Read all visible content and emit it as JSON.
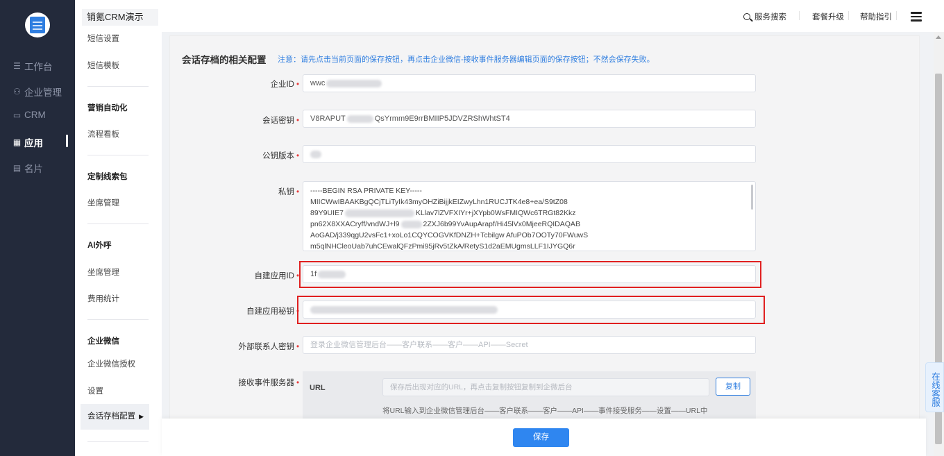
{
  "rail": {
    "items": [
      {
        "icon": "list-icon",
        "label": "工作台"
      },
      {
        "icon": "org-icon",
        "label": "企业管理"
      },
      {
        "icon": "crm-icon",
        "label": "CRM"
      },
      {
        "icon": "grid-icon",
        "label": "应用"
      },
      {
        "icon": "card-icon",
        "label": "名片"
      }
    ]
  },
  "submenu": {
    "title": "销氪CRM演示",
    "items": {
      "sms_settings": "短信设置",
      "sms_templates": "短信模板",
      "group_marketing": "营销自动化",
      "flow_board": "流程看板",
      "group_leads": "定制线索包",
      "seat_manage_1": "坐席管理",
      "group_ai": "AI外呼",
      "seat_manage_2": "坐席管理",
      "cost_stats": "费用统计",
      "group_wework": "企业微信",
      "wework_auth": "企业微信授权",
      "settings": "设置",
      "archive_config": "会话存档配置"
    }
  },
  "topbar": {
    "search": "服务搜索",
    "upgrade": "套餐升级",
    "help": "帮助指引"
  },
  "form": {
    "title": "会话存档的相关配置",
    "note": "注意：请先点击当前页面的保存按钮，再点击企业微信-接收事件服务器编辑页面的保存按钮；不然会保存失败。",
    "corp_id": {
      "label": "企业ID",
      "value_prefix": "wwc"
    },
    "session_secret": {
      "label": "会话密钥",
      "value_prefix": "V8RAPUT",
      "value_suffix": "QsYrmm9E9rrBMIIP5JDVZRShWhtST4"
    },
    "pubkey_version": {
      "label": "公钥版本",
      "value": ""
    },
    "private_key": {
      "label": "私钥",
      "lines": [
        "-----BEGIN RSA PRIVATE KEY-----",
        "MIICWwIBAAKBgQCjTLiTyIk43myOHZiBijjkEIZwyLhn1RUCJTK4e8+ea/S9tZ08",
        "89Y9UIE7",
        "KLlav7lZVFXIYr+jXYpb0WsFMIQWc6TRGt82Kkz",
        "pn62X8XXACryff/vndWJ+l9",
        "2ZXJ6b99YvAupArapf/Hi45lVx0MjeeRQIDAQAB",
        "AoGAD/j339qgU2vsFc1+xoLo1CQYCOGVKfDNZH+Tcbilgw AfuPOb7OOTy70FWuwS",
        "m5qlNHCleoUab7uhCEwalQFzPmi95jRv5tZkA/RetyS1d2aEMUgmsLLF1IJYGQ6r"
      ]
    },
    "app_id": {
      "label": "自建应用ID",
      "value_prefix": "1f"
    },
    "app_secret": {
      "label": "自建应用秘钥"
    },
    "contact_secret": {
      "label": "外部联系人密钥",
      "placeholder": "登录企业微信管理后台——客户联系——客户——API——Secret"
    },
    "event_server": {
      "label": "接收事件服务器",
      "url_label": "URL",
      "url_placeholder": "保存后出现对应的URL，再点击复制按钮复制到企微后台",
      "copy_button": "复制",
      "help": "将URL输入到企业微信管理后台——客户联系——客户——API——事件接受服务——设置——URL中"
    }
  },
  "save_button": "保存",
  "online_service": "在线客服",
  "colors": {
    "primary": "#2f86f0",
    "highlight_border": "#e02020",
    "required": "#e63b3b",
    "rail_bg": "#232a3b"
  }
}
